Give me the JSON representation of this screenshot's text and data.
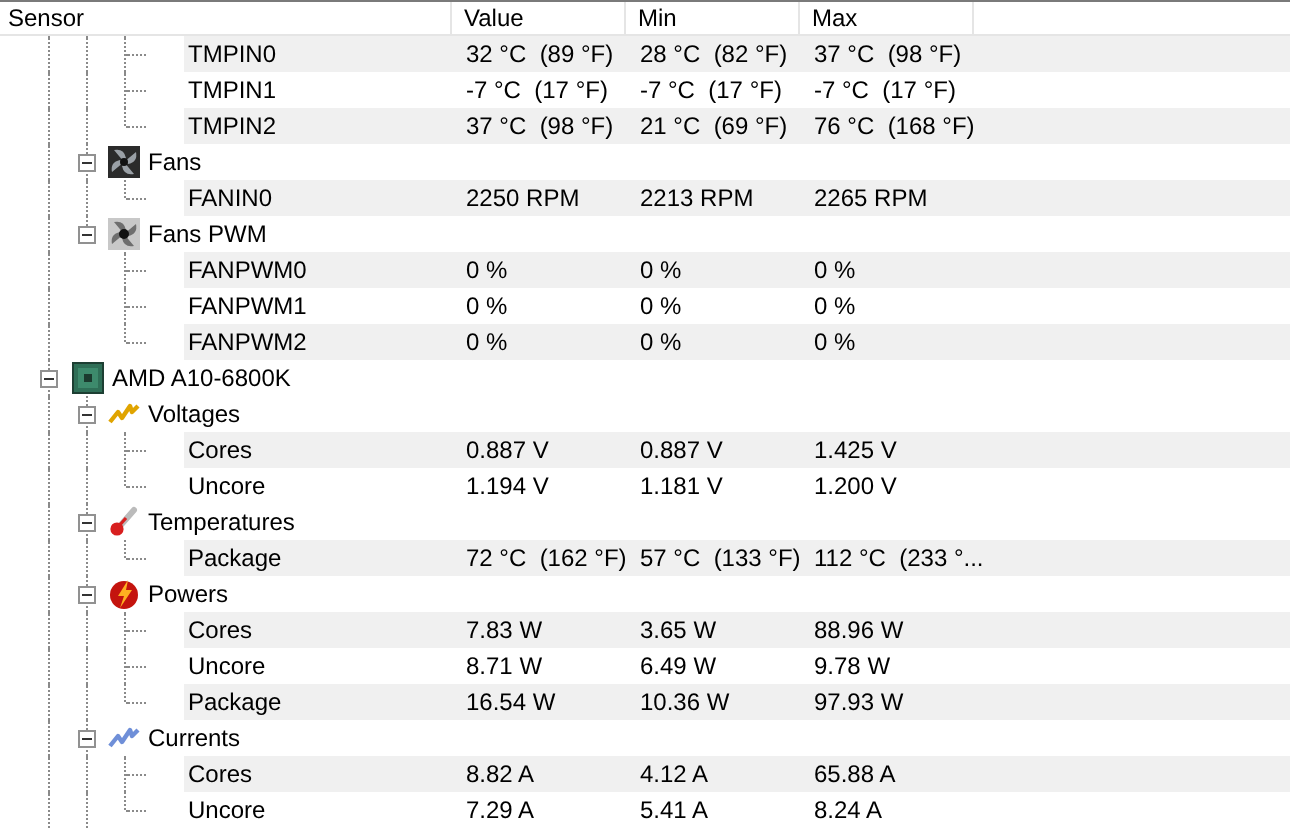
{
  "columns": [
    "Sensor",
    "Value",
    "Min",
    "Max"
  ],
  "tree": [
    {
      "children": [
        {
          "children": [
            {
              "kind": "sensor",
              "label": "TMPIN0",
              "values": [
                "32 °C  (89 °F)",
                "28 °C  (82 °F)",
                "37 °C  (98 °F)"
              ]
            },
            {
              "kind": "sensor",
              "label": "TMPIN1",
              "values": [
                "-7 °C  (17 °F)",
                "-7 °C  (17 °F)",
                "-7 °C  (17 °F)"
              ]
            },
            {
              "kind": "sensor",
              "label": "TMPIN2",
              "values": [
                "37 °C  (98 °F)",
                "21 °C  (69 °F)",
                "76 °C  (168 °F)"
              ]
            }
          ]
        },
        {
          "kind": "fan",
          "label": "Fans",
          "expanded": true,
          "children": [
            {
              "kind": "sensor",
              "label": "FANIN0",
              "values": [
                "2250 RPM",
                "2213 RPM",
                "2265 RPM"
              ]
            }
          ]
        },
        {
          "kind": "fan-pwm",
          "label": "Fans PWM",
          "expanded": true,
          "children": [
            {
              "kind": "sensor",
              "label": "FANPWM0",
              "values": [
                "0 %",
                "0 %",
                "0 %"
              ]
            },
            {
              "kind": "sensor",
              "label": "FANPWM1",
              "values": [
                "0 %",
                "0 %",
                "0 %"
              ]
            },
            {
              "kind": "sensor",
              "label": "FANPWM2",
              "values": [
                "0 %",
                "0 %",
                "0 %"
              ]
            }
          ]
        }
      ]
    },
    {
      "kind": "cpu",
      "label": "AMD A10-6800K",
      "expanded": true,
      "children": [
        {
          "kind": "voltage",
          "label": "Voltages",
          "expanded": true,
          "children": [
            {
              "kind": "sensor",
              "label": "Cores",
              "values": [
                "0.887 V",
                "0.887 V",
                "1.425 V"
              ]
            },
            {
              "kind": "sensor",
              "label": "Uncore",
              "values": [
                "1.194 V",
                "1.181 V",
                "1.200 V"
              ]
            }
          ]
        },
        {
          "kind": "temperature",
          "label": "Temperatures",
          "expanded": true,
          "children": [
            {
              "kind": "sensor",
              "label": "Package",
              "values": [
                "72 °C  (162 °F)",
                "57 °C  (133 °F)",
                "112 °C  (233 °..."
              ]
            }
          ]
        },
        {
          "kind": "power",
          "label": "Powers",
          "expanded": true,
          "children": [
            {
              "kind": "sensor",
              "label": "Cores",
              "values": [
                "7.83 W",
                "3.65 W",
                "88.96 W"
              ]
            },
            {
              "kind": "sensor",
              "label": "Uncore",
              "values": [
                "8.71 W",
                "6.49 W",
                "9.78 W"
              ]
            },
            {
              "kind": "sensor",
              "label": "Package",
              "values": [
                "16.54 W",
                "10.36 W",
                "97.93 W"
              ]
            }
          ]
        },
        {
          "kind": "current",
          "label": "Currents",
          "expanded": true,
          "children": [
            {
              "kind": "sensor",
              "label": "Cores",
              "values": [
                "8.82 A",
                "4.12 A",
                "65.88 A"
              ]
            },
            {
              "kind": "sensor",
              "label": "Uncore",
              "values": [
                "7.29 A",
                "5.41 A",
                "8.24 A"
              ]
            }
          ]
        }
      ]
    }
  ]
}
